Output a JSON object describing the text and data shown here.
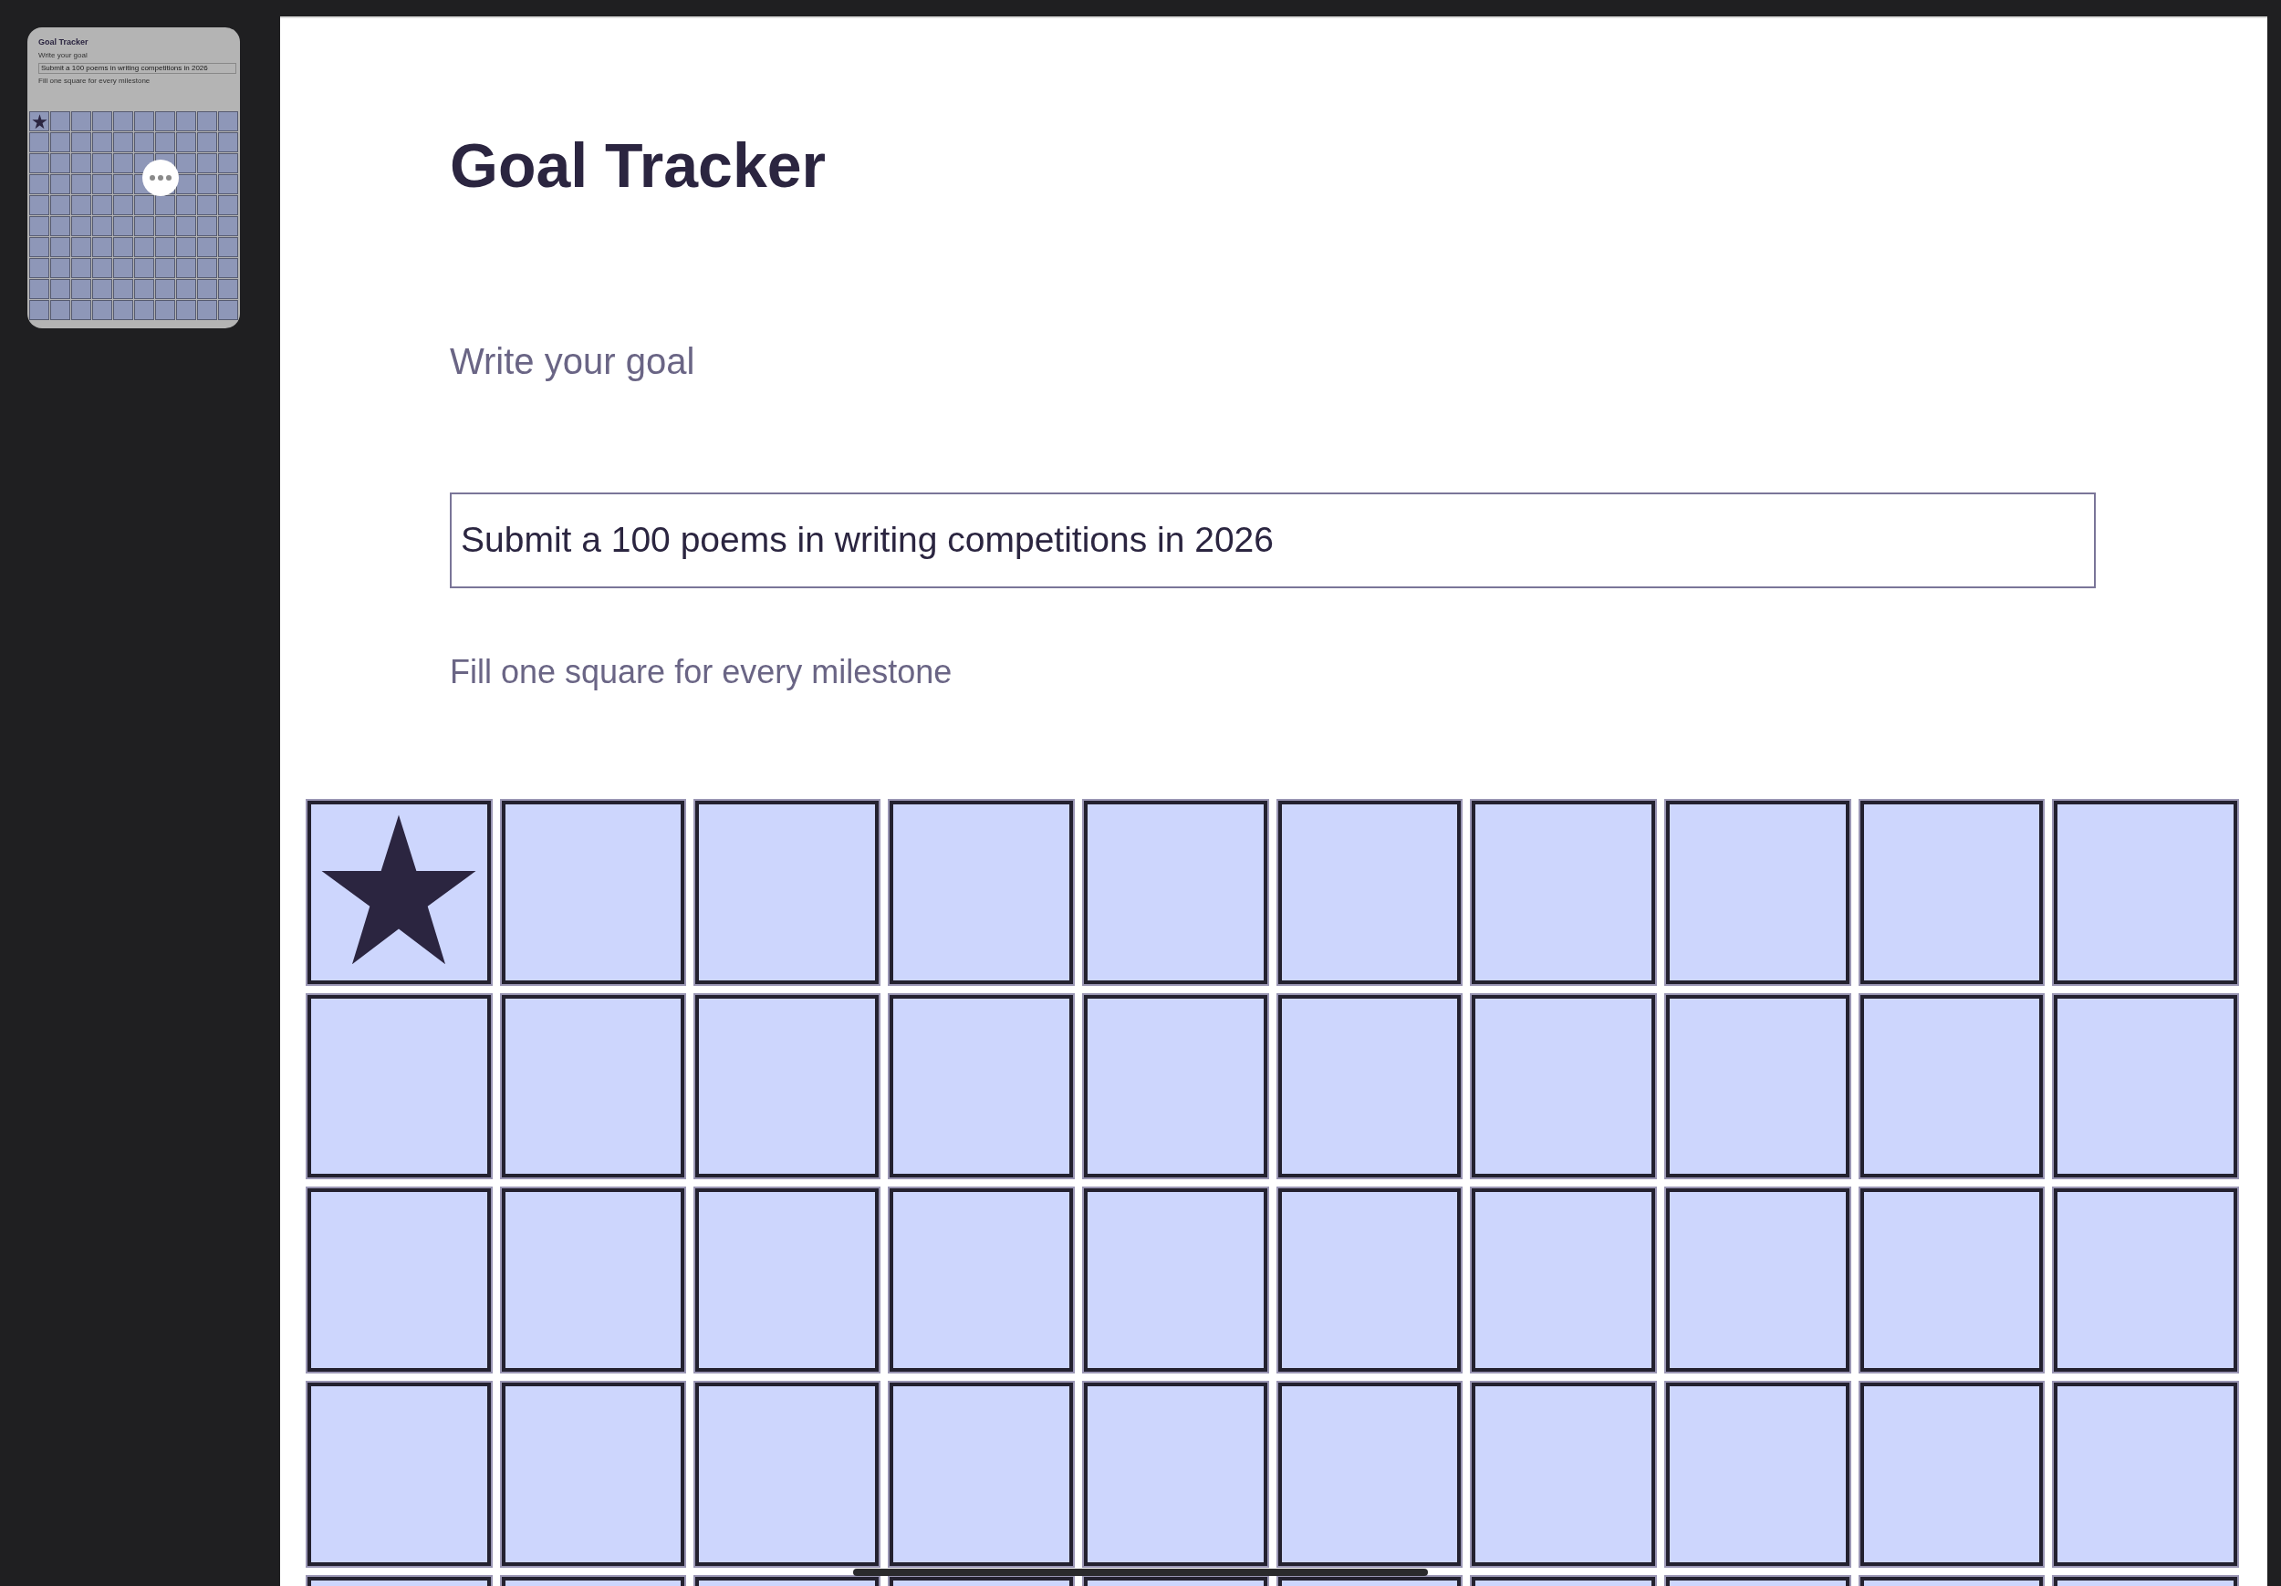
{
  "document": {
    "title": "Goal Tracker",
    "goal_label": "Write your goal",
    "goal_input": {
      "value": "Submit a 100 poems in writing competitions in 2026"
    },
    "grid_label": "Fill one square for every milestone"
  },
  "grid_rows": [
    {
      "squares": [
        {
          "filled": true
        },
        {
          "filled": false
        },
        {
          "filled": false
        },
        {
          "filled": false
        },
        {
          "filled": false
        },
        {
          "filled": false
        },
        {
          "filled": false
        },
        {
          "filled": false
        },
        {
          "filled": false
        },
        {
          "filled": false
        }
      ]
    },
    {
      "squares": [
        {
          "filled": false
        },
        {
          "filled": false
        },
        {
          "filled": false
        },
        {
          "filled": false
        },
        {
          "filled": false
        },
        {
          "filled": false
        },
        {
          "filled": false
        },
        {
          "filled": false
        },
        {
          "filled": false
        },
        {
          "filled": false
        }
      ]
    },
    {
      "squares": [
        {
          "filled": false
        },
        {
          "filled": false
        },
        {
          "filled": false
        },
        {
          "filled": false
        },
        {
          "filled": false
        },
        {
          "filled": false
        },
        {
          "filled": false
        },
        {
          "filled": false
        },
        {
          "filled": false
        },
        {
          "filled": false
        }
      ]
    },
    {
      "squares": [
        {
          "filled": false
        },
        {
          "filled": false
        },
        {
          "filled": false
        },
        {
          "filled": false
        },
        {
          "filled": false
        },
        {
          "filled": false
        },
        {
          "filled": false
        },
        {
          "filled": false
        },
        {
          "filled": false
        },
        {
          "filled": false
        }
      ]
    },
    {
      "squares": [
        {
          "filled": false
        },
        {
          "filled": false
        },
        {
          "filled": false
        },
        {
          "filled": false
        },
        {
          "filled": false
        },
        {
          "filled": false
        },
        {
          "filled": false
        },
        {
          "filled": false
        },
        {
          "filled": false
        },
        {
          "filled": false
        }
      ]
    },
    {
      "squares": [
        {
          "filled": false
        },
        {
          "filled": false
        },
        {
          "filled": false
        },
        {
          "filled": false
        },
        {
          "filled": false
        },
        {
          "filled": false
        },
        {
          "filled": false
        },
        {
          "filled": false
        },
        {
          "filled": false
        },
        {
          "filled": false
        }
      ]
    },
    {
      "squares": [
        {
          "filled": false
        },
        {
          "filled": false
        },
        {
          "filled": false
        },
        {
          "filled": false
        },
        {
          "filled": false
        },
        {
          "filled": false
        },
        {
          "filled": false
        },
        {
          "filled": false
        },
        {
          "filled": false
        },
        {
          "filled": false
        }
      ]
    },
    {
      "squares": [
        {
          "filled": false
        },
        {
          "filled": false
        },
        {
          "filled": false
        },
        {
          "filled": false
        },
        {
          "filled": false
        },
        {
          "filled": false
        },
        {
          "filled": false
        },
        {
          "filled": false
        },
        {
          "filled": false
        },
        {
          "filled": false
        }
      ]
    },
    {
      "squares": [
        {
          "filled": false
        },
        {
          "filled": false
        },
        {
          "filled": false
        },
        {
          "filled": false
        },
        {
          "filled": false
        },
        {
          "filled": false
        },
        {
          "filled": false
        },
        {
          "filled": false
        },
        {
          "filled": false
        },
        {
          "filled": false
        }
      ]
    },
    {
      "squares": [
        {
          "filled": false
        },
        {
          "filled": false
        },
        {
          "filled": false
        },
        {
          "filled": false
        },
        {
          "filled": false
        },
        {
          "filled": false
        },
        {
          "filled": false
        },
        {
          "filled": false
        },
        {
          "filled": false
        },
        {
          "filled": false
        }
      ]
    }
  ],
  "thumbnail": {
    "selected": true,
    "title": "Goal Tracker",
    "goal_label": "Write your goal",
    "goal_value": "Submit a 100 poems in writing competitions in 2026",
    "grid_label": "Fill one square for every milestone"
  }
}
